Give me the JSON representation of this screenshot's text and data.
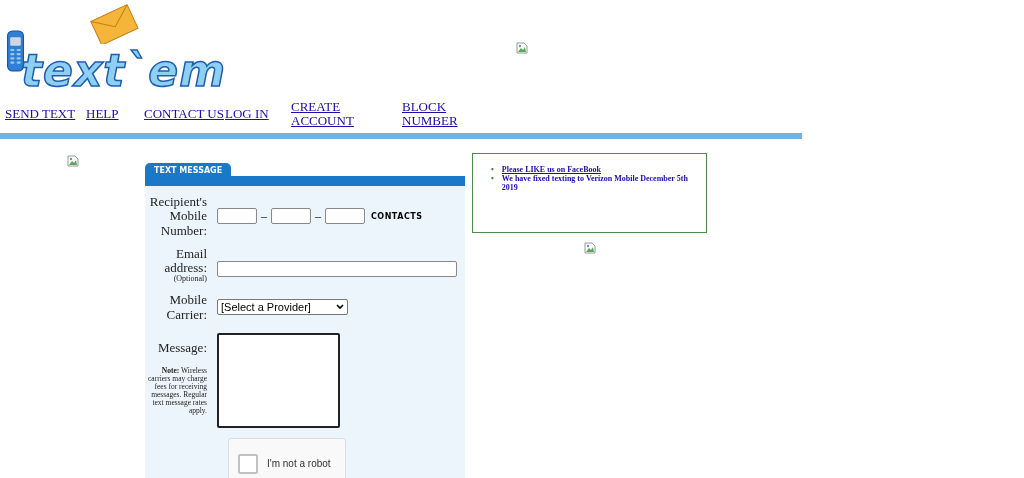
{
  "logo": {
    "text": "text`em"
  },
  "nav": [
    "SEND TEXT",
    "HELP",
    "CONTACT US",
    "LOG IN",
    "CREATE ACCOUNT",
    "BLOCK NUMBER"
  ],
  "form": {
    "tab": "TEXT MESSAGE",
    "fields": [
      {
        "kind": "phone",
        "label": "Recipient's Mobile Number:",
        "separator": "–",
        "extra": "CONTACTS"
      },
      {
        "kind": "text",
        "label": "Email address:",
        "sublabel": "(Optional)"
      },
      {
        "kind": "select",
        "label": "Mobile Carrier:",
        "value": "[Select a Provider]"
      },
      {
        "kind": "textarea",
        "label": "Message:",
        "note": "**Note:** Wireless carriers may charge fees for receiving messages. Regular text message rates apply."
      }
    ],
    "captcha": {
      "label": "I'm not a robot",
      "checked": false
    }
  },
  "news": [
    {
      "bullet": "•",
      "text": "Please LIKE us on FaceBook",
      "link": true
    },
    {
      "bullet": "•",
      "text": "We have fixed texting to Verizon Mobile December 5th 2019",
      "link": false
    }
  ]
}
